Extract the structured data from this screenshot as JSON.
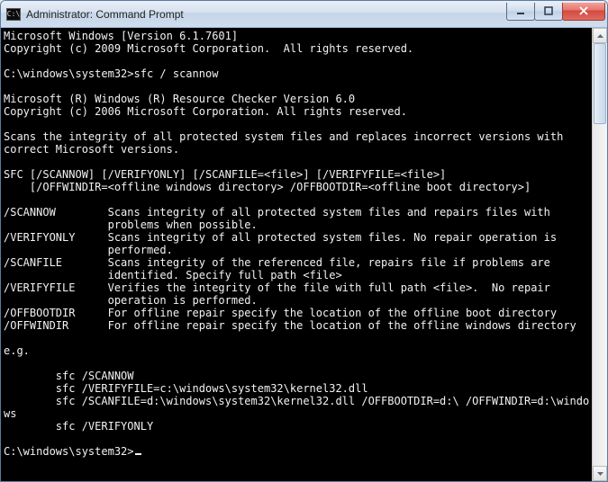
{
  "window": {
    "icon_label": "C:\\",
    "title": "Administrator: Command Prompt"
  },
  "terminal": {
    "lines": [
      "Microsoft Windows [Version 6.1.7601]",
      "Copyright (c) 2009 Microsoft Corporation.  All rights reserved.",
      "",
      "C:\\windows\\system32>sfc / scannow",
      "",
      "Microsoft (R) Windows (R) Resource Checker Version 6.0",
      "Copyright (c) 2006 Microsoft Corporation. All rights reserved.",
      "",
      "Scans the integrity of all protected system files and replaces incorrect versions with",
      "correct Microsoft versions.",
      "",
      "SFC [/SCANNOW] [/VERIFYONLY] [/SCANFILE=<file>] [/VERIFYFILE=<file>]",
      "    [/OFFWINDIR=<offline windows directory> /OFFBOOTDIR=<offline boot directory>]",
      "",
      "/SCANNOW        Scans integrity of all protected system files and repairs files with",
      "                problems when possible.",
      "/VERIFYONLY     Scans integrity of all protected system files. No repair operation is",
      "                performed.",
      "/SCANFILE       Scans integrity of the referenced file, repairs file if problems are",
      "                identified. Specify full path <file>",
      "/VERIFYFILE     Verifies the integrity of the file with full path <file>.  No repair",
      "                operation is performed.",
      "/OFFBOOTDIR     For offline repair specify the location of the offline boot directory",
      "/OFFWINDIR      For offline repair specify the location of the offline windows directory",
      "",
      "e.g.",
      "",
      "        sfc /SCANNOW",
      "        sfc /VERIFYFILE=c:\\windows\\system32\\kernel32.dll",
      "        sfc /SCANFILE=d:\\windows\\system32\\kernel32.dll /OFFBOOTDIR=d:\\ /OFFWINDIR=d:\\windows",
      "        sfc /VERIFYONLY",
      "",
      "C:\\windows\\system32>"
    ]
  }
}
